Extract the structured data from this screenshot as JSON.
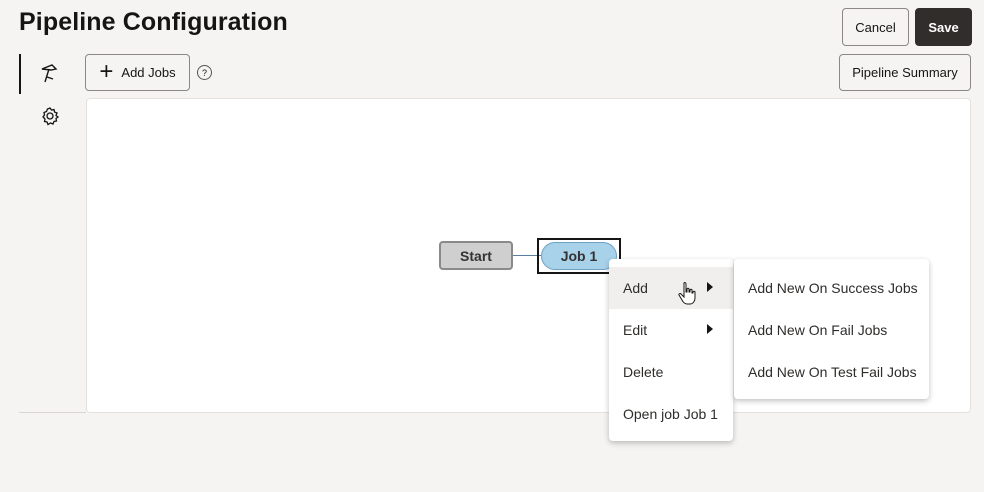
{
  "page": {
    "title": "Pipeline Configuration"
  },
  "header": {
    "cancel_label": "Cancel",
    "save_label": "Save"
  },
  "toolbar": {
    "add_jobs_label": "Add Jobs",
    "help_glyph": "?",
    "summary_label": "Pipeline Summary"
  },
  "sidebar": {
    "items": [
      {
        "icon": "hammer-icon",
        "active": true
      },
      {
        "icon": "gear-icon",
        "active": false
      }
    ]
  },
  "canvas": {
    "nodes": [
      {
        "label": "Start"
      },
      {
        "label": "Job 1"
      }
    ]
  },
  "context_menu": {
    "items": [
      {
        "label": "Add"
      },
      {
        "label": "Edit"
      },
      {
        "label": "Delete"
      },
      {
        "label": "Open job Job 1"
      }
    ]
  },
  "submenu": {
    "items": [
      {
        "label": "Add New On Success Jobs"
      },
      {
        "label": "Add New On Fail Jobs"
      },
      {
        "label": "Add New On Test Fail Jobs"
      }
    ]
  },
  "colors": {
    "save_bg": "#312d2a",
    "job_node": "#a8d1ea",
    "start_node": "#cfcfcf"
  }
}
